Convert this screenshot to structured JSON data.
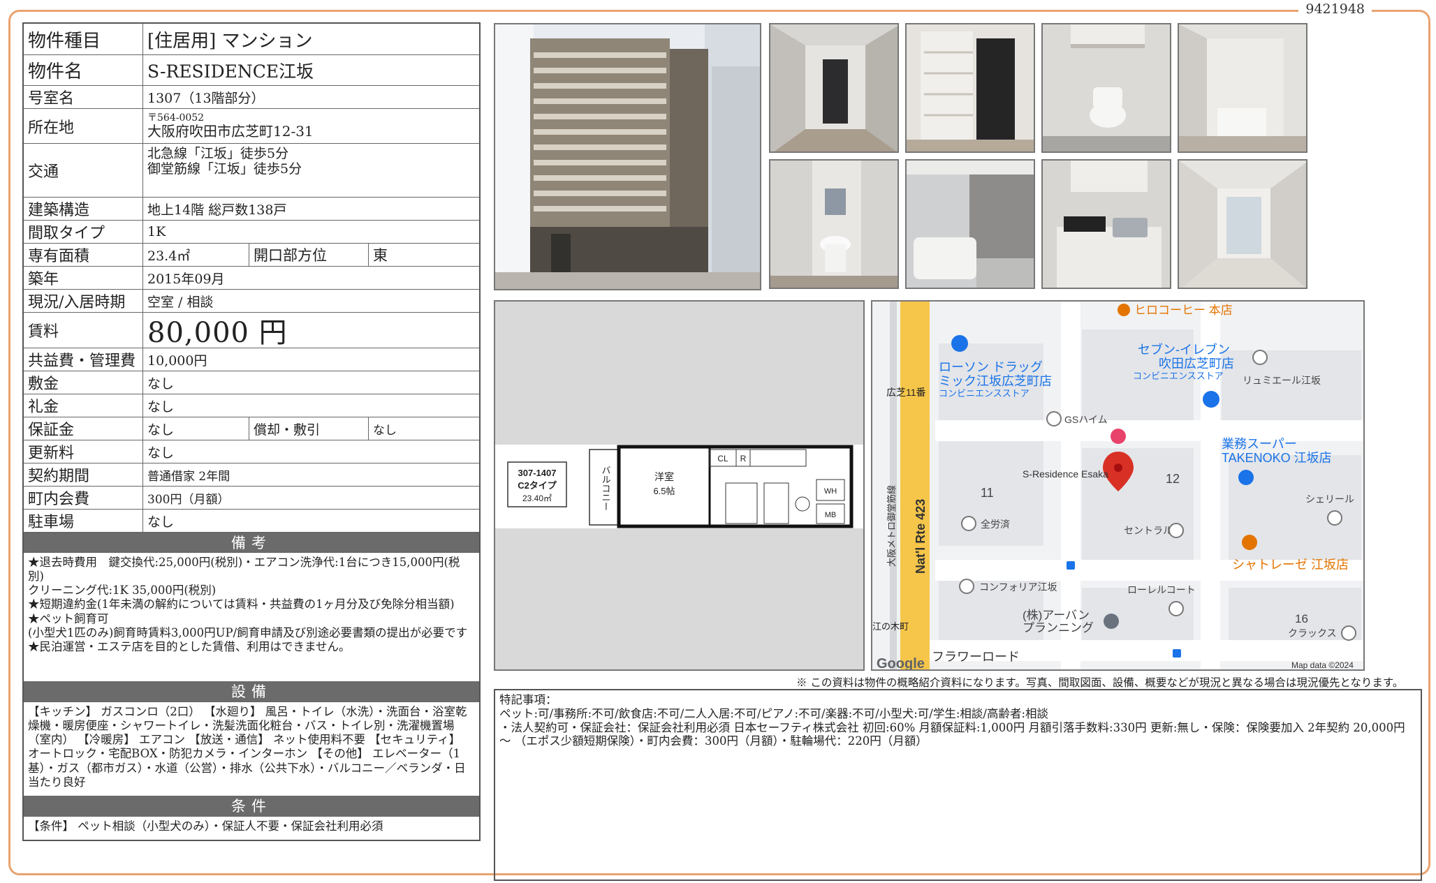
{
  "doc_id": "9421948",
  "spec": {
    "type_label": "物件種目",
    "type_value": "[住居用] マンション",
    "name_label": "物件名",
    "name_value": "S-RESIDENCE江坂",
    "room_label": "号室名",
    "room_value": "1307（13階部分）",
    "address_label": "所在地",
    "postal": "〒564-0052",
    "address_value": "大阪府吹田市広芝町12-31",
    "access_label": "交通",
    "access_1": "北急線「江坂」徒歩5分",
    "access_2": "御堂筋線「江坂」徒歩5分",
    "structure_label": "建築構造",
    "structure_value": "地上14階 総戸数138戸",
    "layout_label": "間取タイプ",
    "layout_value": "1K",
    "area_label": "専有面積",
    "area_value": "23.4㎡",
    "direction_label": "開口部方位",
    "direction_value": "東",
    "built_label": "築年",
    "built_value": "2015年09月",
    "status_label": "現況/入居時期",
    "status_value": "空室 / 相談",
    "rent_label": "賃料",
    "rent_value": "80,000 円",
    "fee_label": "共益費・管理費",
    "fee_value": "10,000円",
    "deposit_label": "敷金",
    "deposit_value": "なし",
    "key_money_label": "礼金",
    "key_money_value": "なし",
    "guarantee_label": "保証金",
    "guarantee_value": "なし",
    "amort_label": "償却・敷引",
    "amort_value": "なし",
    "renewal_label": "更新料",
    "renewal_value": "なし",
    "contract_label": "契約期間",
    "contract_value": "普通借家 2年間",
    "town_label": "町内会費",
    "town_value": "300円（月額）",
    "parking_label": "駐車場",
    "parking_value": "なし"
  },
  "bikou": {
    "title": "備考",
    "lines": [
      "★退去時費用　鍵交換代:25,000円(税別)・エアコン洗浄代:1台につき15,000円(税別)",
      "クリーニング代:1K 35,000円(税別)",
      "★短期違約金(1年未満の解約については賃料・共益費の1ヶ月分及び免除分相当額)",
      "★ペット飼育可",
      "(小型犬1匹のみ)飼育時賃料3,000円UP/飼育申請及び別途必要書類の提出が必要です",
      "★民泊運営・エステ店を目的とした賃借、利用はできません。"
    ]
  },
  "setsubi": {
    "title": "設備",
    "text": "【キッチン】 ガスコンロ（2口） 【水廻り】 風呂・トイレ（水洗）・洗面台・浴室乾燥機・暖房便座・シャワートイレ・洗髪洗面化粧台・バス・トイレ別・洗濯機置場（室内） 【冷暖房】 エアコン 【放送・通信】 ネット使用料不要 【セキュリティ】 オートロック・宅配BOX・防犯カメラ・インターホン 【その他】 エレベーター（1基）・ガス（都市ガス）・水道（公営）・排水（公共下水）・バルコニー／ベランダ・日当たり良好"
  },
  "jouken": {
    "title": "条件",
    "text": "【条件】 ペット相談（小型犬のみ）・保証人不要・保証会社利用必須"
  },
  "floorplan": {
    "room_no": "307-1407",
    "type": "C2タイプ",
    "area": "23.40㎡",
    "balcony": "バルコニー",
    "room_name": "洋室",
    "room_size": "6.5帖",
    "cl": "CL",
    "r": "R",
    "wh": "WH",
    "mb": "MB"
  },
  "map": {
    "poi_hiro": "ヒロコーヒー 本店",
    "poi_lawson_1": "ローソン ドラッグ",
    "poi_lawson_2": "ミック江坂広芝町店",
    "poi_lawson_3": "コンビニエンスストア",
    "poi_seven_1": "セブン-イレブン",
    "poi_seven_2": "吹田広芝町店",
    "poi_seven_3": "コンビニエンスストア",
    "poi_ryumi": "リュミエール江坂",
    "poi_gs": "GSハイム",
    "poi_gyomu_1": "業務スーパー",
    "poi_gyomu_2": "TAKENOKO 江坂店",
    "poi_sres": "S-Residence Esaka",
    "poi_sherir": "シェリール",
    "poi_zenrou": "全労済",
    "poi_central": "セントラル",
    "poi_chateraise": "シャトレーゼ 江坂店",
    "poi_conforia": "コンフォリア江坂",
    "poi_laurel": "ローレルコート",
    "poi_urban_1": "(株)アーバン",
    "poi_urban_2": "プランニング",
    "poi_clax": "クラックス",
    "block_11": "11",
    "block_12": "12",
    "block_16": "16",
    "hiroshiba": "広芝11番",
    "enoki": "江の木町",
    "route": "Nat'l Rte 423",
    "subway": "大阪メトロ御堂筋線",
    "flower": "フラワーロード",
    "google": "Google",
    "mapdata": "Map data ©2024"
  },
  "note": "※ この資料は物件の概略紹介資料になります。写真、間取図面、設備、概要などが現況と異なる場合は現況優先となります。",
  "remarks": {
    "title": "特記事項：",
    "line1": "ペット:可/事務所:不可/飲食店:不可/二人入居:不可/ピアノ:不可/楽器:不可/小型犬:可/学生:相談/高齢者:相談",
    "line2": "・法人契約可・保証会社：保証会社利用必須 日本セーフティ株式会社 初回:60% 月額保証料:1,000円 月額引落手数料:330円 更新:無し・保険：保険要加入 2年契約 20,000円 〜 （エポス少額短期保険）・町内会費：300円（月額）・駐輪場代：220円（月額）"
  },
  "colors": {
    "frame": "#e9a36f",
    "section_bg": "#6b6b6b",
    "map_road": "#f6c64a",
    "map_pin": "#d93025",
    "map_blue": "#1a73e8"
  }
}
